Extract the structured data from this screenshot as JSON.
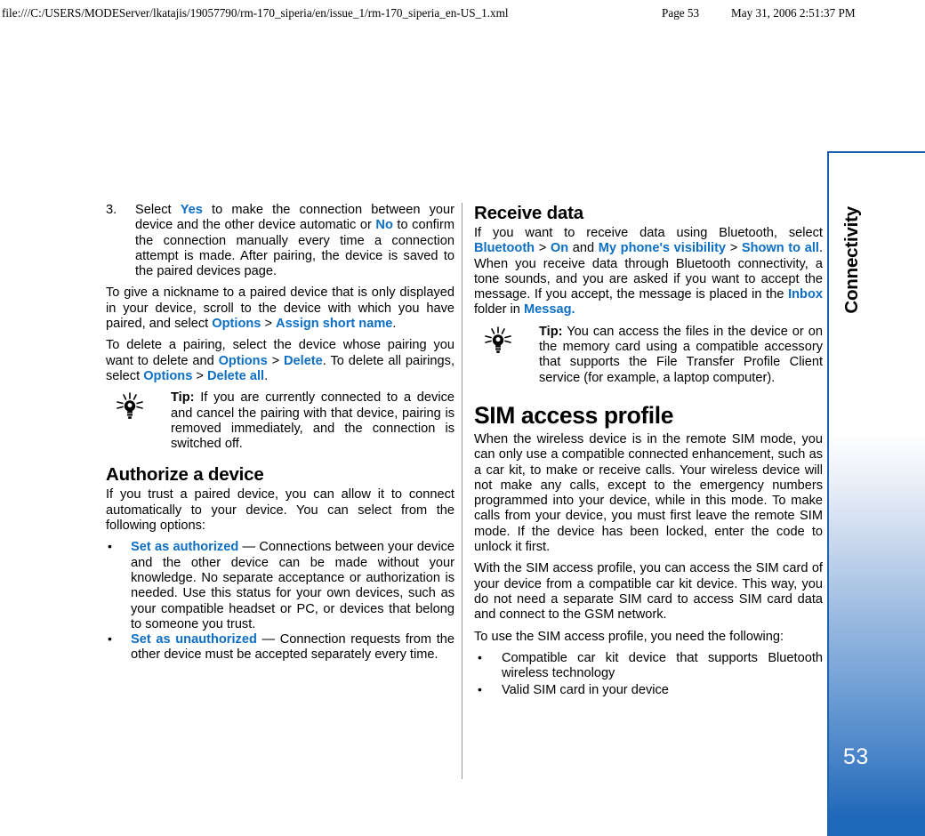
{
  "print_header": {
    "path": "file:///C:/USERS/MODEServer/lkatajis/19057790/rm-170_siperia/en/issue_1/rm-170_siperia_en-US_1.xml",
    "page": "Page 53",
    "date": "May 31, 2006 2:51:37 PM"
  },
  "sidebar": {
    "chapter_label": "Connectivity",
    "page_number": "53",
    "accent_color": "#2069b8",
    "border_color": "#1f64ae"
  },
  "colors": {
    "link": "#0d6fc4",
    "text": "#000000",
    "divider": "#9a9a9a"
  },
  "left_column": {
    "step3": {
      "number": "3.",
      "parts": [
        {
          "t": "Select ",
          "k": "plain"
        },
        {
          "t": "Yes",
          "k": "link"
        },
        {
          "t": " to make the connection between your device and the other device automatic or ",
          "k": "plain"
        },
        {
          "t": "No",
          "k": "link"
        },
        {
          "t": " to confirm the connection manually every time a connection attempt is made. After pairing, the device is saved to the paired devices page.",
          "k": "plain"
        }
      ]
    },
    "para_nickname": {
      "parts": [
        {
          "t": "To give a nickname to a paired device that is only displayed in your device, scroll to the device with which you have paired, and select ",
          "k": "plain"
        },
        {
          "t": "Options",
          "k": "link"
        },
        {
          "t": " > ",
          "k": "plain"
        },
        {
          "t": "Assign short name",
          "k": "link"
        },
        {
          "t": ".",
          "k": "plain"
        }
      ]
    },
    "para_delete": {
      "parts": [
        {
          "t": "To delete a pairing, select the device whose pairing you want to delete and ",
          "k": "plain"
        },
        {
          "t": "Options",
          "k": "link"
        },
        {
          "t": " > ",
          "k": "plain"
        },
        {
          "t": "Delete",
          "k": "link"
        },
        {
          "t": ". To delete all pairings, select ",
          "k": "plain"
        },
        {
          "t": "Options",
          "k": "link"
        },
        {
          "t": " > ",
          "k": "plain"
        },
        {
          "t": "Delete all",
          "k": "link"
        },
        {
          "t": ".",
          "k": "plain"
        }
      ]
    },
    "tip1": {
      "label": "Tip:",
      "text": " If you are currently connected to a device and cancel the pairing with that device, pairing is removed immediately, and the connection is switched off."
    },
    "heading_authorize": "Authorize a device",
    "para_authorize": "If you trust a paired device, you can allow it to connect automatically to your device. You can select from the following options:",
    "bullets": [
      {
        "parts": [
          {
            "t": "Set as authorized",
            "k": "link"
          },
          {
            "t": " — Connections between your device and the other device can be made without your knowledge. No separate acceptance or authorization is needed. Use this status for your own devices, such as your compatible headset or PC, or devices that belong to someone you trust.",
            "k": "plain"
          }
        ]
      },
      {
        "parts": [
          {
            "t": "Set as unauthorized",
            "k": "link"
          },
          {
            "t": " — Connection requests from the other device must be accepted separately every time.",
            "k": "plain"
          }
        ]
      }
    ]
  },
  "right_column": {
    "heading_receive": "Receive data",
    "para_receive": {
      "parts": [
        {
          "t": "If you want to receive data using Bluetooth, select ",
          "k": "plain"
        },
        {
          "t": "Bluetooth",
          "k": "link"
        },
        {
          "t": " > ",
          "k": "plain"
        },
        {
          "t": "On",
          "k": "link"
        },
        {
          "t": " and ",
          "k": "plain"
        },
        {
          "t": "My phone's visibility",
          "k": "link"
        },
        {
          "t": " > ",
          "k": "plain"
        },
        {
          "t": "Shown to all",
          "k": "link"
        },
        {
          "t": ". When you receive data through Bluetooth connectivity, a tone sounds, and you are asked if you want to accept the message. If you accept, the message is placed in the ",
          "k": "plain"
        },
        {
          "t": "Inbox",
          "k": "link"
        },
        {
          "t": " folder in ",
          "k": "plain"
        },
        {
          "t": "Messag.",
          "k": "link"
        }
      ]
    },
    "tip2": {
      "label": "Tip:",
      "text": " You can access the files in the device or on the memory card using a compatible accessory that supports the File Transfer Profile Client service (for example, a laptop computer)."
    },
    "heading_sim": "SIM access profile",
    "para_sim1": "When the wireless device is in the remote SIM mode, you can only use a compatible connected enhancement, such as a car kit, to make or receive calls. Your wireless device will not make any calls, except to the emergency numbers programmed into your device, while in this mode. To make calls from your device, you must first leave the remote SIM mode. If the device has been locked, enter the code to unlock it first.",
    "para_sim2": "With the SIM access profile, you can access the SIM card of your device from a compatible car kit device. This way, you do not need a separate SIM card to access SIM card data and connect to the GSM network.",
    "para_sim3": "To use the SIM access profile, you need the following:",
    "bullets": [
      "Compatible car kit device that supports Bluetooth wireless technology",
      "Valid SIM card in your device"
    ]
  }
}
